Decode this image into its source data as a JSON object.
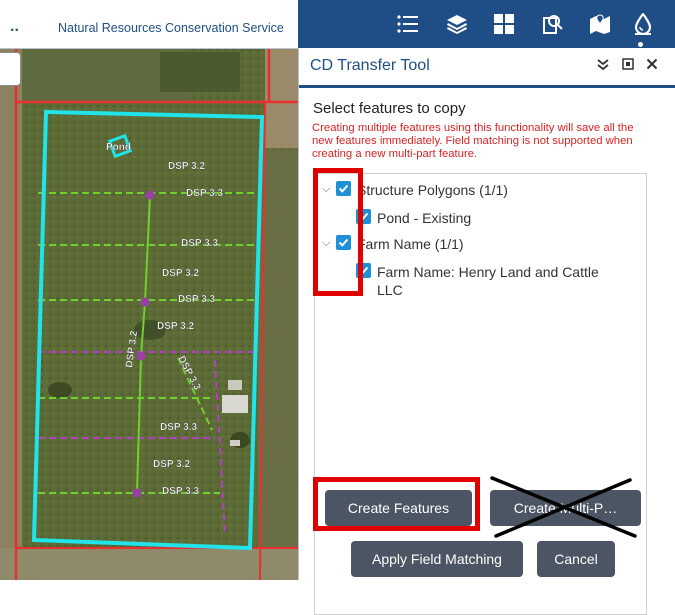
{
  "header": {
    "org": "Natural Resources Conservation Service",
    "menu_dots": ".."
  },
  "map": {
    "labels": [
      "Pond",
      "DSP 3.2",
      "DSP 3.3",
      "DSP 3.3",
      "DSP 3.2",
      "DSP 3.3",
      "DSP 3.2",
      "DSP 3.2",
      "DSP 3.3",
      "DSP 3.3",
      "DSP 3.2",
      "DSP 3.3"
    ],
    "colors": {
      "boundary": "#20e4ea",
      "road": "#e83030",
      "dsp": "#70d030",
      "fence": "#b040c0",
      "point": "#9b3fa8"
    }
  },
  "toolbar": {
    "icons": [
      "list-icon",
      "layers-icon",
      "grid-icon",
      "search-document-icon",
      "map-pin-icon",
      "water-drop-icon"
    ]
  },
  "panel": {
    "title": "CD Transfer Tool",
    "select_title": "Select features to copy",
    "warning": "Creating multiple features using this functionality will save all the new features immediately. Field matching is not supported when creating a new multi-part feature.",
    "tree": [
      {
        "label": "Structure Polygons (1/1)",
        "child": "Pond - Existing"
      },
      {
        "label": "Farm Name (1/1)",
        "child": "Farm Name: Henry Land and Cattle LLC"
      }
    ],
    "buttons": {
      "create": "Create Features",
      "create_multi": "Create Multi-P…",
      "apply": "Apply Field Matching",
      "cancel": "Cancel"
    }
  },
  "theme": {
    "accent": "#1f4e86",
    "button": "#4b5563",
    "checkbox": "#1e90d6",
    "annotation": "#e00000"
  }
}
